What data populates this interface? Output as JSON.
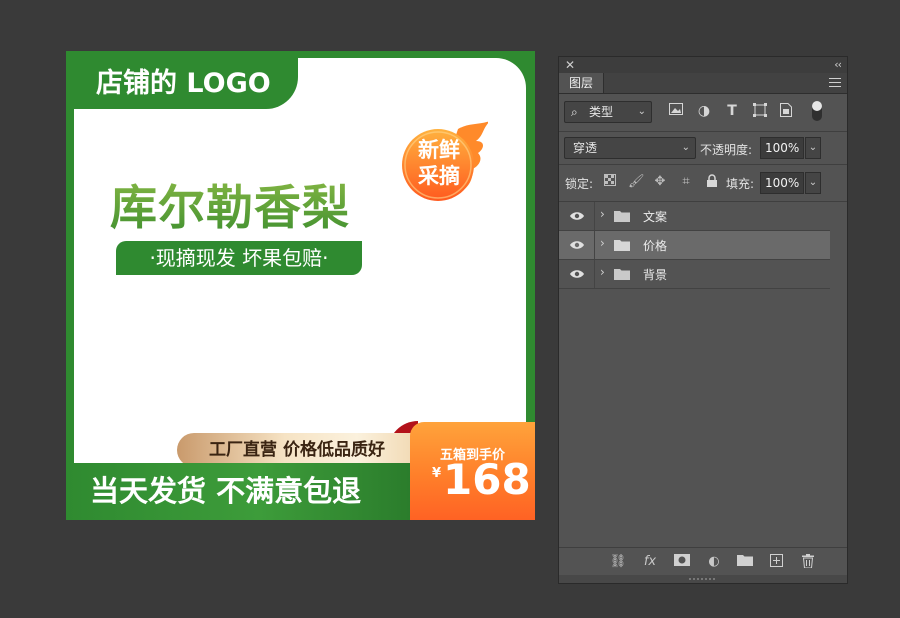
{
  "canvas": {
    "logo_text": "店铺的 LOGO",
    "title": "库尔勒香梨",
    "subtitle": "·现摘现发  坏果包赔·",
    "badge": {
      "line1": "新鲜",
      "line2": "采摘"
    },
    "gold_banner": "工厂直营 价格低品质好",
    "bottom_slogan": "当天发货 不满意包退",
    "price_label": "五箱到手价",
    "price_currency": "¥",
    "price_value": "168"
  },
  "panel": {
    "close_glyph": "✕",
    "collapse_glyph": "‹‹",
    "tab": "图层",
    "filter": {
      "search_glyph": "⌕",
      "value": "类型"
    },
    "filter_icons": [
      "image-filter-icon",
      "adjustment-filter-icon",
      "type-filter-icon",
      "shape-filter-icon",
      "smart-object-filter-icon"
    ],
    "blend_mode": "穿透",
    "opacity_label": "不透明度:",
    "opacity_value": "100%",
    "lock_label": "锁定:",
    "fill_label": "填充:",
    "fill_value": "100%",
    "layers": [
      {
        "name": "文案",
        "visible": true,
        "selected": false
      },
      {
        "name": "价格",
        "visible": true,
        "selected": true
      },
      {
        "name": "背景",
        "visible": true,
        "selected": false
      }
    ],
    "bottom_icons": [
      "link-layers-icon",
      "fx-icon",
      "add-mask-icon",
      "adjustment-layer-icon",
      "new-group-icon",
      "new-layer-icon",
      "delete-layer-icon"
    ]
  },
  "colors": {
    "brand_green": "#2f8a30",
    "price_orange": "#ff7f2a",
    "ps_panel": "#535353",
    "ps_background": "#3a3a3a"
  }
}
